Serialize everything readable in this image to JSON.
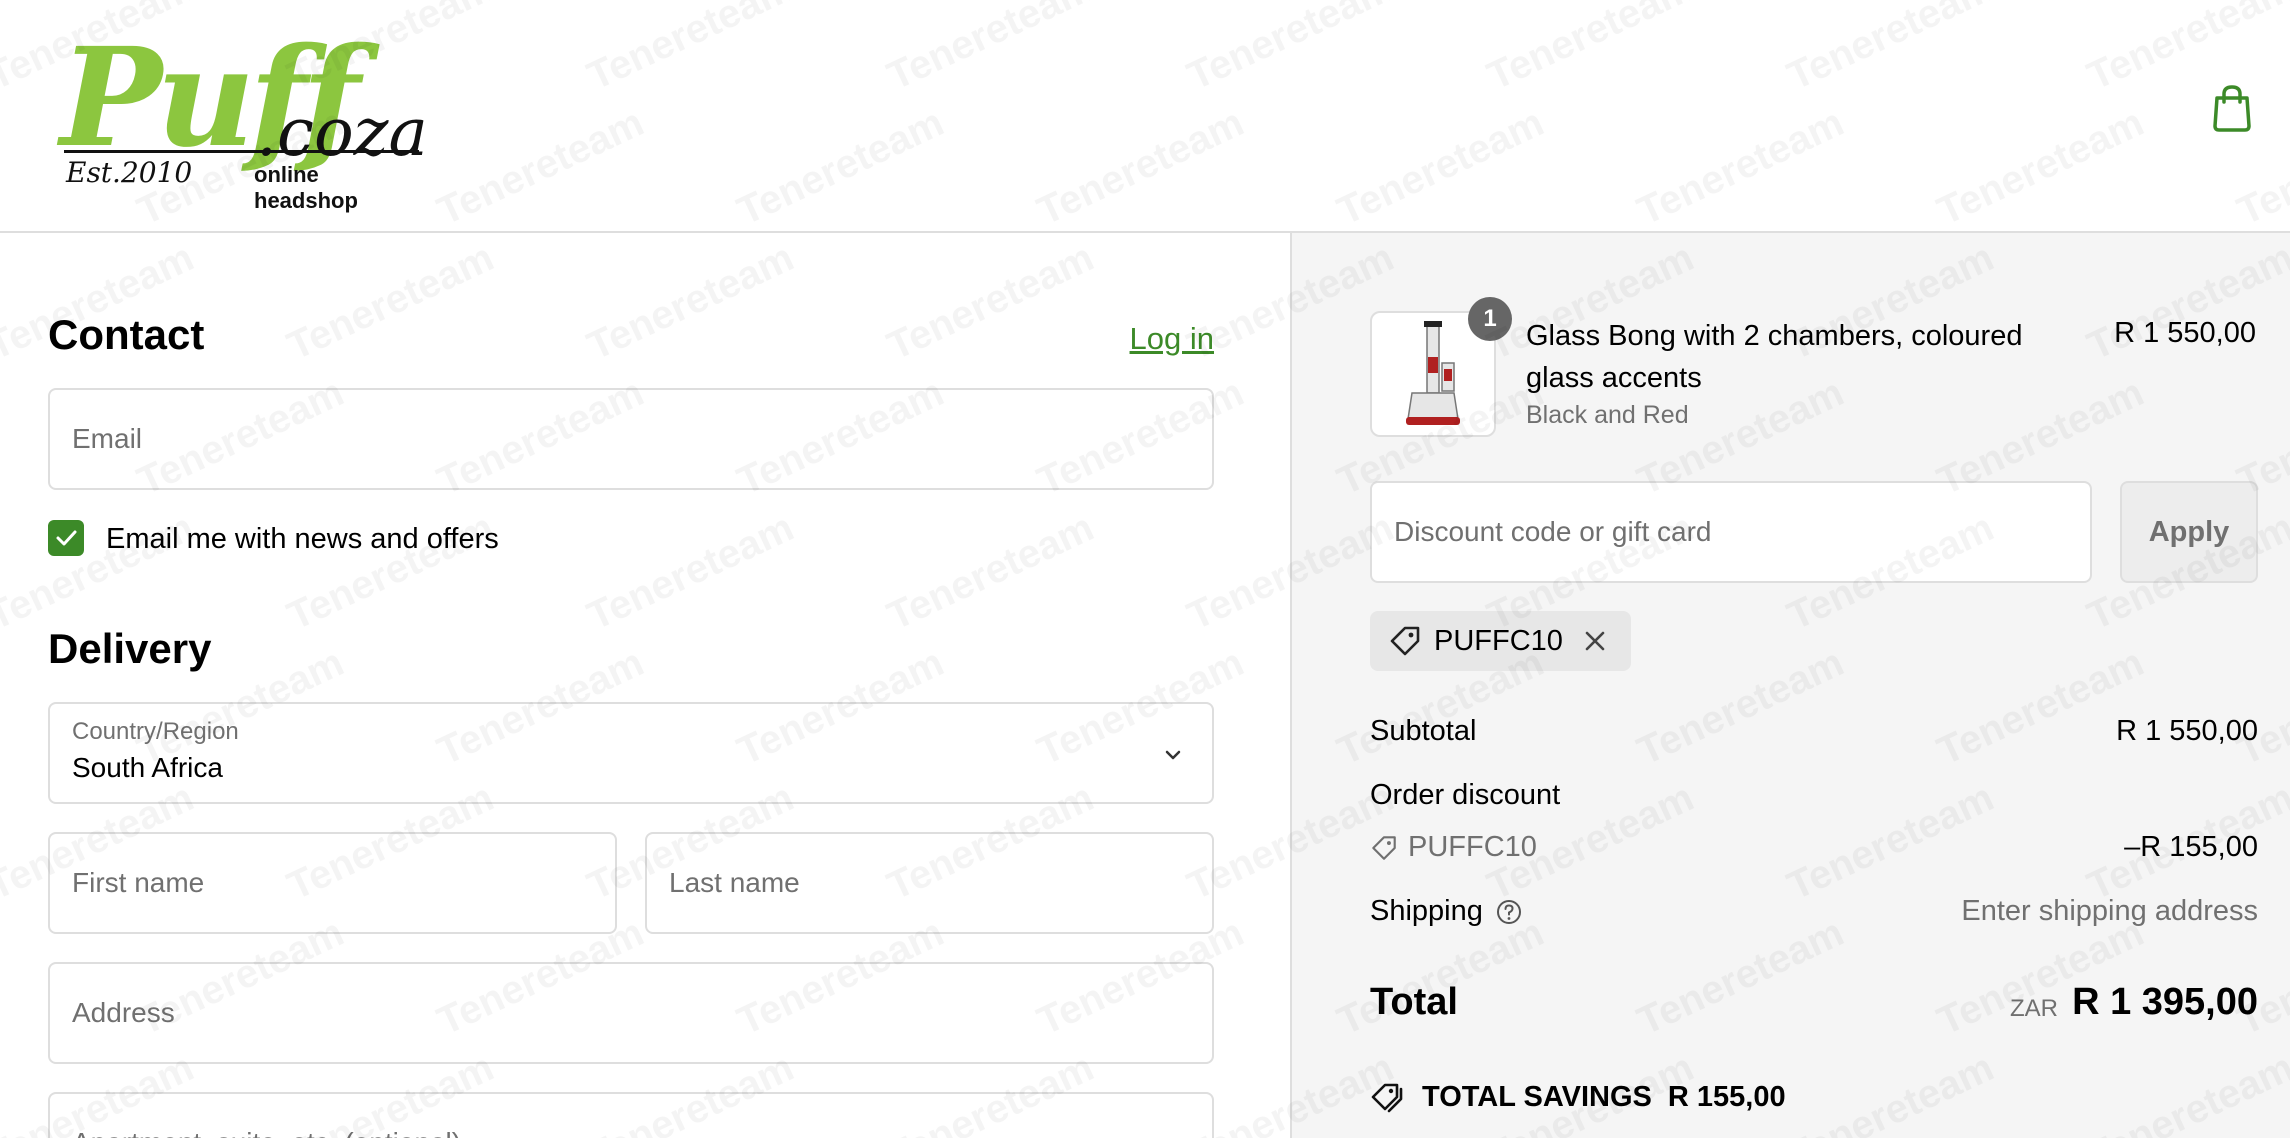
{
  "header": {
    "logo_main": "Puff",
    "logo_coza": ".coza",
    "logo_est": "Est.2010",
    "logo_sub": "online headshop"
  },
  "watermark_text": "Tenereteam",
  "contact": {
    "title": "Contact",
    "login_label": "Log in",
    "email_placeholder": "Email",
    "news_label": "Email me with news and offers",
    "news_checked": true
  },
  "delivery": {
    "title": "Delivery",
    "country_label": "Country/Region",
    "country_value": "South Africa",
    "first_name_placeholder": "First name",
    "last_name_placeholder": "Last name",
    "address_placeholder": "Address",
    "apartment_placeholder": "Apartment, suite, etc. (optional)"
  },
  "summary": {
    "item": {
      "quantity": "1",
      "name": "Glass Bong with 2 chambers, coloured glass accents",
      "variant": "Black and Red",
      "price": "R 1 550,00"
    },
    "discount_placeholder": "Discount code or gift card",
    "apply_label": "Apply",
    "applied_code": "PUFFC10",
    "subtotal_label": "Subtotal",
    "subtotal_value": "R 1 550,00",
    "order_discount_label": "Order discount",
    "discount_code": "PUFFC10",
    "discount_value": "–R 155,00",
    "shipping_label": "Shipping",
    "shipping_value": "Enter shipping address",
    "total_label": "Total",
    "total_currency": "ZAR",
    "total_value": "R 1 395,00",
    "savings_label": "TOTAL SAVINGS",
    "savings_value": "R 155,00"
  },
  "colors": {
    "accent_green": "#3c8a28",
    "logo_green": "#8cc63f",
    "border": "#dedede",
    "summary_bg": "#f5f5f5"
  }
}
